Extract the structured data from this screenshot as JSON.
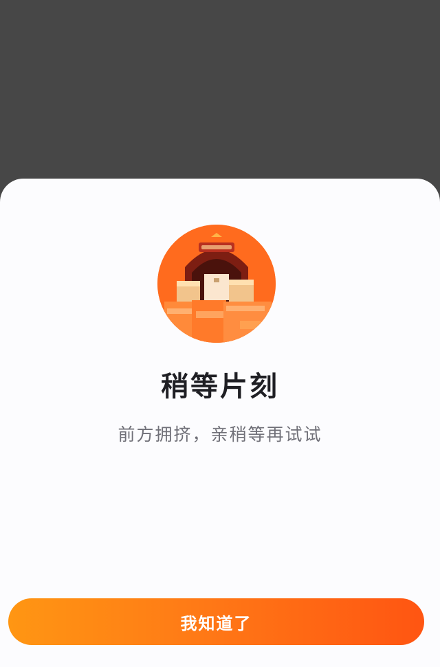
{
  "dialog": {
    "illustration": "warehouse-boxes-illustration",
    "title": "稍等片刻",
    "message": "前方拥挤，亲稍等再试试",
    "confirm_label": "我知道了"
  },
  "colors": {
    "backdrop": "#474747",
    "sheet_background": "#fcfcfe",
    "accent_start": "#ff9613",
    "accent_end": "#ff5512",
    "title_text": "#1f1f24",
    "message_text": "#707078"
  }
}
